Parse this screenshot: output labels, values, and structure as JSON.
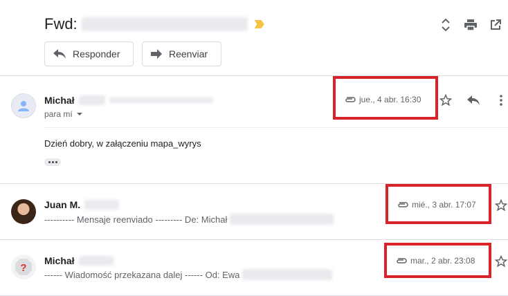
{
  "thread": {
    "subject_prefix": "Fwd:",
    "actions": {
      "reply_label": "Responder",
      "forward_label": "Reenviar"
    }
  },
  "messages": [
    {
      "sender": "Michał",
      "recipient_line": "para mí",
      "date": "jue., 4 abr. 16:30",
      "body": "Dzień dobry, w załączeniu mapa_wyrys",
      "has_attachment": true,
      "expanded": true
    },
    {
      "sender": "Juan M.",
      "snippet": "---------- Mensaje reenviado --------- De: Michał",
      "date": "mié., 3 abr. 17:07",
      "has_attachment": true,
      "expanded": false
    },
    {
      "sender": "Michał",
      "snippet": "------ Wiadomość przekazana dalej ------ Od: Ewa",
      "date": "mar., 2 abr. 23:08",
      "has_attachment": true,
      "expanded": false
    }
  ],
  "icons": {
    "important_marker": "important-marker-icon",
    "expand_collapse": "unfold-icon",
    "print": "print-icon",
    "open_new_window": "open-in-new-icon",
    "reply": "reply-icon",
    "forward": "forward-icon",
    "attachment": "paperclip-icon",
    "star": "star-outline-icon",
    "more": "more-vert-icon"
  },
  "colors": {
    "highlight_border": "#d8232a",
    "important_marker": "#f6c344",
    "divider": "#dadce0",
    "muted_text": "#5f6368"
  }
}
